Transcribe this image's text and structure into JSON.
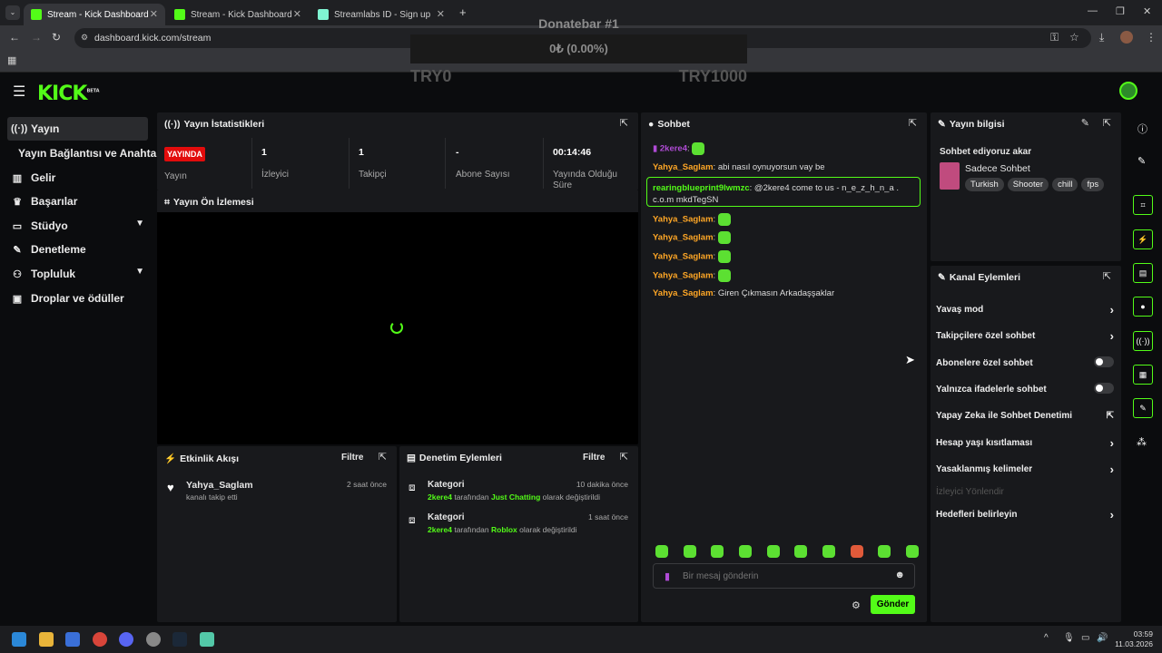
{
  "browser": {
    "tabs": [
      {
        "title": "Stream - Kick Dashboard",
        "active": true
      },
      {
        "title": "Stream - Kick Dashboard",
        "active": false
      },
      {
        "title": "Streamlabs ID - Sign up",
        "active": false
      }
    ],
    "url": "dashboard.kick.com/stream"
  },
  "donatebar": {
    "title": "Donatebar #1",
    "amount": "0₺ (0.00%)",
    "min": "TRY0",
    "max": "TRY1000"
  },
  "app": {
    "logo": "KICK",
    "logo_badge": "BETA"
  },
  "sidebar": {
    "items": [
      {
        "label": "Yayın",
        "icon": "broadcast-icon"
      },
      {
        "label": "Yayın Bağlantısı ve Anahtarı",
        "icon": ""
      },
      {
        "label": "Gelir",
        "icon": "chart-icon"
      },
      {
        "label": "Başarılar",
        "icon": "trophy-icon"
      },
      {
        "label": "Stüdyo",
        "icon": "studio-icon"
      },
      {
        "label": "Denetleme",
        "icon": "wrench-icon"
      },
      {
        "label": "Topluluk",
        "icon": "people-icon"
      },
      {
        "label": "Droplar ve ödüller",
        "icon": "gift-icon"
      }
    ]
  },
  "stats": {
    "title": "Yayın İstatistikleri",
    "live_badge": "YAYINDA",
    "items": [
      {
        "value": "",
        "label": "Yayın"
      },
      {
        "value": "1",
        "label": "İzleyici"
      },
      {
        "value": "1",
        "label": "Takipçi"
      },
      {
        "value": "-",
        "label": "Abone Sayısı"
      },
      {
        "value": "00:14:46",
        "label": "Yayında Olduğu Süre"
      }
    ]
  },
  "preview": {
    "title": "Yayın Ön İzlemesi"
  },
  "activity": {
    "title": "Etkinlik Akışı",
    "filter": "Filtre",
    "events": [
      {
        "user": "Yahya_Saglam",
        "desc": "kanalı takip etti",
        "time": "2 saat önce"
      }
    ]
  },
  "moderation": {
    "title": "Denetim Eylemleri",
    "filter": "Filtre",
    "actions": [
      {
        "title": "Kategori",
        "time": "10 dakika önce",
        "actor": "2kere4",
        "mid": "tarafından",
        "target": "Just Chatting",
        "suffix": "olarak değiştirildi"
      },
      {
        "title": "Kategori",
        "time": "1 saat önce",
        "actor": "2kere4",
        "mid": "tarafından",
        "target": "Roblox",
        "suffix": "olarak değiştirildi"
      }
    ]
  },
  "chat": {
    "title": "Sohbet",
    "messages": [
      {
        "user": "2kere4",
        "text": ""
      },
      {
        "user": "Yahya_Saglam",
        "text": "abi nasıl oynuyorsun vay be"
      },
      {
        "user": "rearingblueprint9lwmzc",
        "text": "@2kere4 come to us - n_e_z_h_n_a . c.o.m mkdTegSN"
      },
      {
        "user": "Yahya_Saglam",
        "text": ""
      },
      {
        "user": "Yahya_Saglam",
        "text": ""
      },
      {
        "user": "Yahya_Saglam",
        "text": ""
      },
      {
        "user": "Yahya_Saglam",
        "text": ""
      },
      {
        "user": "Yahya_Saglam",
        "text": "Giren Çıkmasın Arkadaşşaklar"
      }
    ],
    "placeholder": "Bir mesaj gönderin",
    "send": "Gönder"
  },
  "streaminfo": {
    "title": "Yayın bilgisi",
    "stream_title": "Sohbet ediyoruz akar",
    "category": "Sadece Sohbet",
    "tags": [
      "Turkish",
      "Shooter",
      "chill",
      "fps"
    ]
  },
  "channel_actions": {
    "title": "Kanal Eylemleri",
    "items": [
      {
        "label": "Yavaş mod",
        "control": "chevron"
      },
      {
        "label": "Takipçilere özel sohbet",
        "control": "chevron"
      },
      {
        "label": "Abonelere özel sohbet",
        "control": "toggle"
      },
      {
        "label": "Yalnızca ifadelerle sohbet",
        "control": "toggle"
      },
      {
        "label": "Yapay Zeka ile Sohbet Denetimi",
        "control": "external"
      },
      {
        "label": "Hesap yaşı kısıtlaması",
        "control": "chevron"
      },
      {
        "label": "Yasaklanmış kelimeler",
        "control": "chevron"
      },
      {
        "label": "İzleyici Yönlendir",
        "control": "disabled"
      },
      {
        "label": "Hedefleri belirleyin",
        "control": "chevron"
      }
    ]
  },
  "taskbar": {
    "time": "03:59",
    "date": "11.03.2026"
  },
  "colors": {
    "accent": "#53fc18",
    "live": "#e20c0c",
    "username": "#ffa726"
  }
}
